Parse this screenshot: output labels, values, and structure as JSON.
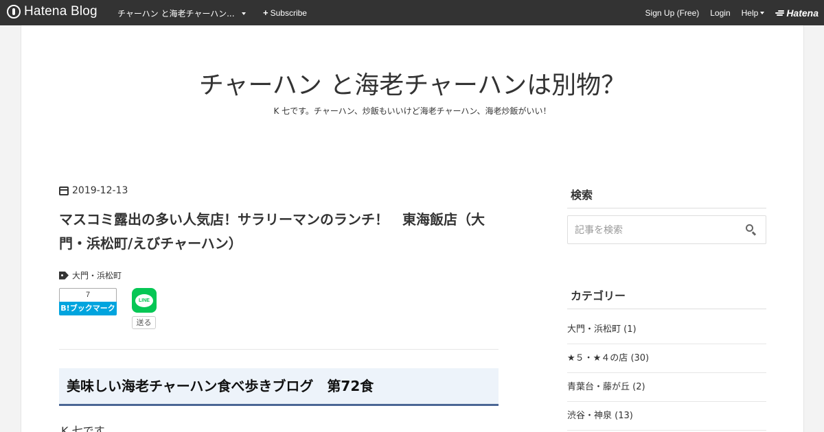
{
  "topbar": {
    "logo_text": "Hatena Blog",
    "blog_select": "チャーハン と海老チャーハン...",
    "subscribe": "Subscribe",
    "signup": "Sign Up (Free)",
    "login": "Login",
    "help": "Help",
    "hatena": "Hatena"
  },
  "header": {
    "title": "チャーハン と海老チャーハンは別物？",
    "description": "K 七です。チャーハン、炒飯もいいけど海老チャーハン、海老炒飯がいい！"
  },
  "article": {
    "date": "2019-12-13",
    "title": "マスコミ露出の多い人気店！サラリーマンのランチ！　東海飯店（大門・浜松町/えびチャーハン）",
    "tag": "大門・浜松町",
    "bookmark_count": "7",
    "bookmark_label": "B!ブックマーク",
    "line_label": "LINE",
    "send_label": "送る",
    "section_heading": "美味しい海老チャーハン食べ歩きブログ　第72食",
    "body_first_line": "K 七です。"
  },
  "sidebar": {
    "search_title": "検索",
    "search_placeholder": "記事を検索",
    "category_title": "カテゴリー",
    "categories": [
      "大門・浜松町 (1)",
      "★５・★４の店 (30)",
      "青葉台・藤が丘 (2)",
      "渋谷・神泉 (13)"
    ]
  },
  "colors": {
    "topbar": "#333333",
    "bookmark_blue": "#00a4de",
    "line_green": "#06c755",
    "heading_bg": "#edf3fa",
    "heading_border": "#4a6694"
  }
}
